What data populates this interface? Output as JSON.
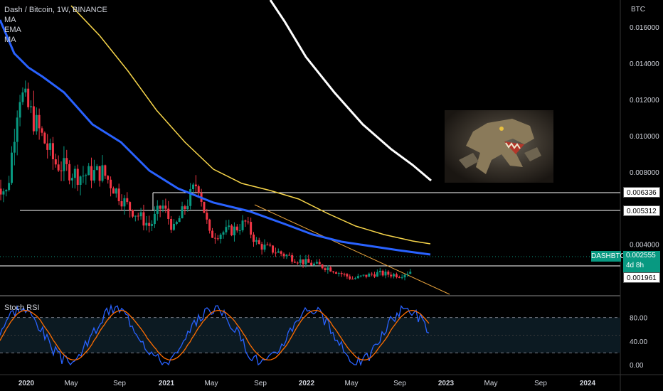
{
  "legend": {
    "symbol_line": "Dash / Bitcoin, 1W, BINANCE",
    "ind1": "MA",
    "ind2": "EMA",
    "ind3": "MA"
  },
  "currency_label": "BTC",
  "price_axis": {
    "ticks": [
      "0.016000",
      "0.014000",
      "0.012000",
      "0.010000",
      "0.008000",
      "0.004000"
    ]
  },
  "levels": [
    {
      "label": "0.006336",
      "value": 0.006336
    },
    {
      "label": "0.005312",
      "value": 0.005312
    },
    {
      "label": "0.001961",
      "value": 0.001961
    }
  ],
  "current": {
    "symbol": "DASHBTC",
    "price": "0.002555",
    "countdown": "4d 8h"
  },
  "time_axis": [
    "2020",
    "May",
    "Sep",
    "2021",
    "May",
    "Sep",
    "2022",
    "May",
    "Sep",
    "2023",
    "May",
    "Sep",
    "2024"
  ],
  "rsi": {
    "title": "Stoch RSI",
    "ticks": [
      "80.00",
      "40.00",
      "0.00"
    ],
    "band_upper": 80,
    "band_lower": 20
  },
  "colors": {
    "up": "#089981",
    "down": "#f23645",
    "ma_blue": "#2962ff",
    "ema_yellow": "#f7d54a",
    "ma_white": "#ffffff",
    "trendline": "#e8a33d",
    "k_line": "#2962ff",
    "d_line": "#ff6d00",
    "tag": "#089981"
  },
  "chart_data": {
    "type": "candlestick",
    "title": "Dash / Bitcoin, 1W, BINANCE",
    "ylabel": "BTC",
    "ylim": [
      0.0012,
      0.0175
    ],
    "x_range": [
      "2019-12",
      "2024-04"
    ],
    "grid": false,
    "close_trend": [
      [
        "2019-12",
        0.0075
      ],
      [
        "2020-01",
        0.0068
      ],
      [
        "2020-02",
        0.0125
      ],
      [
        "2020-03",
        0.0112
      ],
      [
        "2020-05",
        0.0085
      ],
      [
        "2020-07",
        0.0078
      ],
      [
        "2020-09",
        0.008
      ],
      [
        "2020-11",
        0.0062
      ],
      [
        "2021-01",
        0.005
      ],
      [
        "2021-02",
        0.0062
      ],
      [
        "2021-03",
        0.0048
      ],
      [
        "2021-05",
        0.0075
      ],
      [
        "2021-06",
        0.0045
      ],
      [
        "2021-08",
        0.0048
      ],
      [
        "2021-09",
        0.0052
      ],
      [
        "2021-10",
        0.004
      ],
      [
        "2021-12",
        0.0035
      ],
      [
        "2022-02",
        0.003
      ],
      [
        "2022-04",
        0.0027
      ],
      [
        "2022-06",
        0.0021
      ],
      [
        "2022-08",
        0.0024
      ],
      [
        "2022-10",
        0.0023
      ],
      [
        "2022-11",
        0.00256
      ]
    ],
    "series": [
      {
        "name": "MA",
        "color": "#2962ff"
      },
      {
        "name": "EMA",
        "color": "#f7d54a"
      },
      {
        "name": "MA",
        "color": "#ffffff"
      }
    ]
  }
}
